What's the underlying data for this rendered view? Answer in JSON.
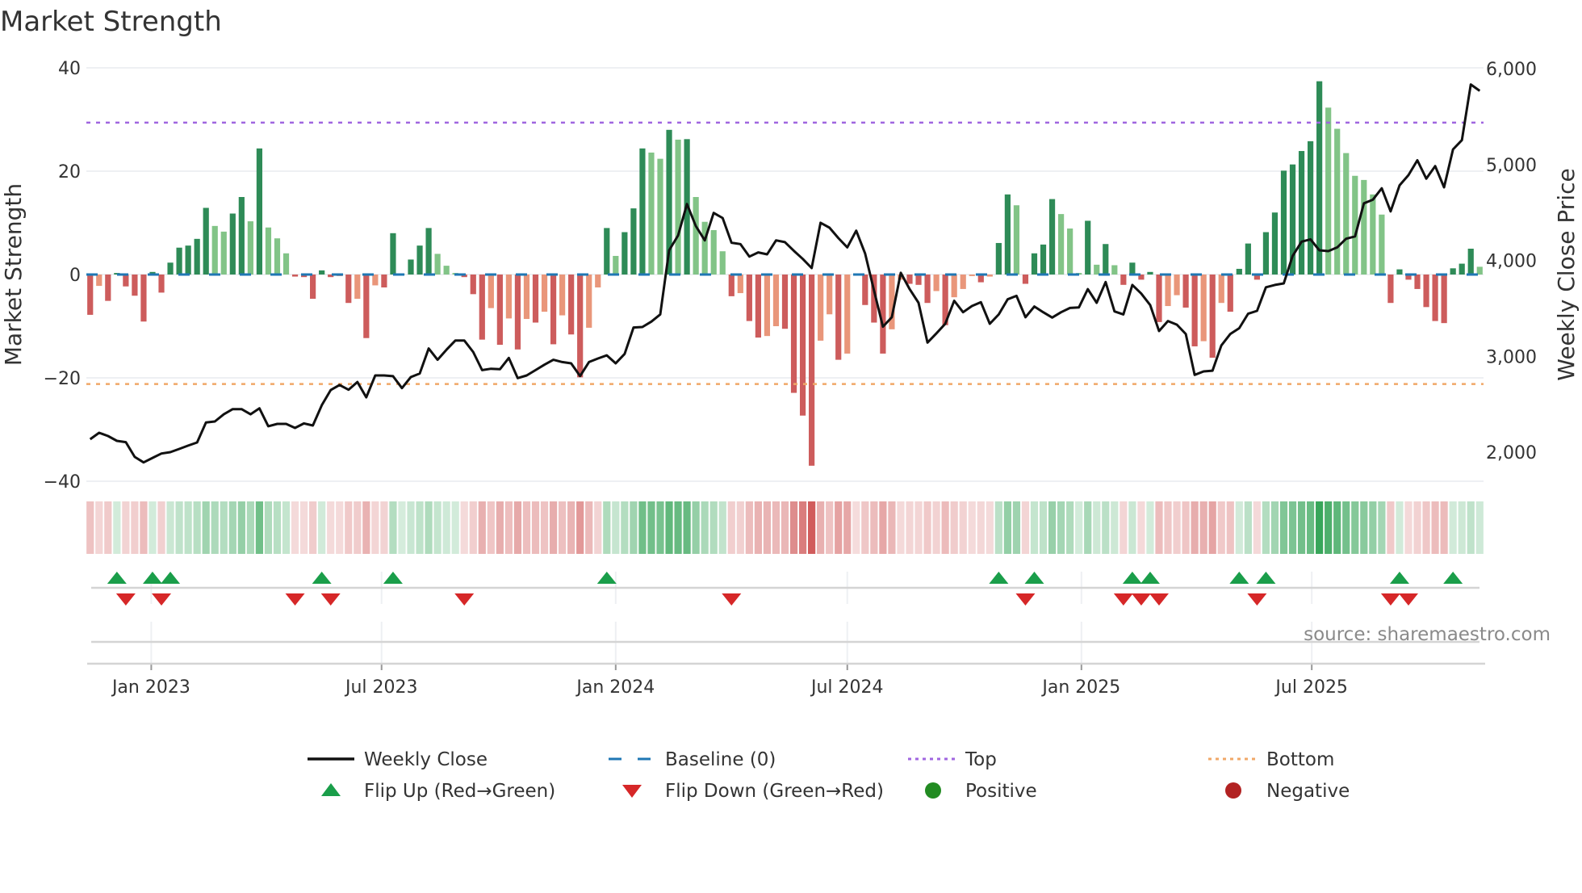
{
  "chart_data": {
    "type": "bar+line",
    "title": "Market Strength",
    "left_axis": {
      "label": "Market Strength",
      "ylim": [
        -40,
        40
      ],
      "ticks": [
        40,
        20,
        0,
        -20,
        -40
      ],
      "tick_labels": [
        "40",
        "20",
        "0",
        "−20",
        "−40"
      ]
    },
    "right_axis": {
      "label": "Weekly Close Price",
      "ylim": [
        1750,
        6000
      ],
      "ticks": [
        6000,
        5000,
        4000,
        3000,
        2000
      ],
      "tick_labels": [
        "6,000",
        "5,000",
        "4,000",
        "3,000",
        "2,000"
      ]
    },
    "x_axis": {
      "xlim": [
        "2022-11-11",
        "2025-11-13"
      ],
      "start_date": "2022-11-14",
      "frequency_days": 7,
      "ticks": [
        {
          "date": "2023-01-01",
          "label": "Jan 2023"
        },
        {
          "date": "2023-07-01",
          "label": "Jul 2023"
        },
        {
          "date": "2024-01-01",
          "label": "Jan 2024"
        },
        {
          "date": "2024-07-01",
          "label": "Jul 2024"
        },
        {
          "date": "2025-01-01",
          "label": "Jan 2025"
        },
        {
          "date": "2025-07-01",
          "label": "Jul 2025"
        }
      ]
    },
    "top_level": 29.4,
    "bottom_level": -21.2,
    "baseline": 0,
    "strength": [
      -7.8,
      -2.2,
      -5.1,
      0.3,
      -2.3,
      -4.1,
      -9.1,
      0.5,
      -3.5,
      2.3,
      5.2,
      5.6,
      6.9,
      12.9,
      9.4,
      8.3,
      11.8,
      15.0,
      10.3,
      24.4,
      9.1,
      7.0,
      4.1,
      -0.4,
      -0.5,
      -4.7,
      0.8,
      -0.5,
      -0.3,
      -5.5,
      -4.7,
      -12.3,
      -2.1,
      -2.5,
      8.0,
      0.1,
      2.9,
      5.6,
      9.0,
      4.0,
      1.7,
      0.3,
      -0.5,
      -3.8,
      -12.6,
      -6.5,
      -13.6,
      -8.5,
      -14.5,
      -8.6,
      -9.3,
      -7.2,
      -13.5,
      -7.9,
      -11.6,
      -19.9,
      -10.3,
      -2.5,
      9.0,
      3.6,
      8.2,
      12.8,
      24.4,
      23.6,
      22.4,
      28.0,
      26.1,
      26.2,
      15.0,
      10.2,
      8.6,
      4.5,
      -4.2,
      -3.6,
      -9.0,
      -12.2,
      -11.9,
      -10.0,
      -10.5,
      -22.9,
      -27.3,
      -37.0,
      -12.8,
      -7.7,
      -16.5,
      -15.3,
      -0.2,
      -5.9,
      -9.3,
      -15.3,
      -10.6,
      -1.0,
      -1.8,
      -2.0,
      -5.5,
      -3.2,
      -9.8,
      -4.4,
      -2.8,
      -0.3,
      -1.5,
      -0.4,
      6.1,
      15.5,
      13.4,
      -1.8,
      4.1,
      5.8,
      14.6,
      11.7,
      8.9,
      0.3,
      10.4,
      1.9,
      5.9,
      1.8,
      -2.0,
      2.3,
      -1.0,
      0.5,
      -9.2,
      -6.1,
      -4.0,
      -6.4,
      -13.9,
      -12.9,
      -16.1,
      -5.5,
      -7.2,
      1.1,
      6.0,
      -1.0,
      8.2,
      12.0,
      20.1,
      21.3,
      23.9,
      25.8,
      37.4,
      32.3,
      28.2,
      23.5,
      19.1,
      18.3,
      15.5,
      11.6,
      -5.5,
      1.0,
      -1.0,
      -2.8,
      -6.3,
      -9.0,
      -9.4,
      1.2,
      2.1,
      5.0,
      1.5
    ],
    "weekly_close": [
      2135,
      2202,
      2168,
      2118,
      2104,
      1950,
      1893,
      1940,
      1986,
      2000,
      2034,
      2068,
      2101,
      2310,
      2320,
      2395,
      2449,
      2449,
      2395,
      2457,
      2270,
      2295,
      2295,
      2253,
      2300,
      2278,
      2490,
      2648,
      2701,
      2651,
      2732,
      2572,
      2800,
      2800,
      2792,
      2668,
      2783,
      2820,
      3081,
      2963,
      3069,
      3165,
      3165,
      3044,
      2856,
      2870,
      2865,
      2983,
      2772,
      2800,
      2856,
      2912,
      2963,
      2940,
      2926,
      2794,
      2940,
      2977,
      3010,
      2926,
      3025,
      3300,
      3305,
      3362,
      3437,
      4105,
      4260,
      4588,
      4358,
      4209,
      4495,
      4442,
      4184,
      4170,
      4040,
      4083,
      4063,
      4209,
      4190,
      4100,
      4015,
      3920,
      4392,
      4341,
      4232,
      4136,
      4310,
      4072,
      3684,
      3309,
      3407,
      3870,
      3700,
      3558,
      3143,
      3239,
      3339,
      3579,
      3459,
      3524,
      3564,
      3339,
      3437,
      3594,
      3630,
      3407,
      3519,
      3459,
      3404,
      3459,
      3504,
      3510,
      3700,
      3558,
      3774,
      3468,
      3437,
      3744,
      3654,
      3534,
      3263,
      3368,
      3330,
      3233,
      2806,
      2842,
      2850,
      3113,
      3233,
      3293,
      3443,
      3474,
      3720,
      3744,
      3760,
      4047,
      4195,
      4220,
      4105,
      4097,
      4136,
      4226,
      4250,
      4595,
      4632,
      4752,
      4511,
      4783,
      4889,
      5044,
      4852,
      4984,
      4762,
      5158,
      5254,
      5835,
      5768
    ],
    "flip_up_weeks": [
      3,
      7,
      9,
      26,
      34,
      58,
      102,
      106,
      117,
      119,
      129,
      132,
      147,
      153
    ],
    "flip_down_weeks": [
      4,
      8,
      23,
      27,
      42,
      72,
      105,
      116,
      118,
      120,
      131,
      146,
      148
    ],
    "legend": {
      "placement": "bottom",
      "items": [
        {
          "key": "close",
          "label": "Weekly Close"
        },
        {
          "key": "baseline",
          "label": "Baseline (0)"
        },
        {
          "key": "top",
          "label": "Top"
        },
        {
          "key": "bottom",
          "label": "Bottom"
        },
        {
          "key": "flip_up",
          "label": "Flip Up (Red→Green)"
        },
        {
          "key": "flip_down",
          "label": "Flip Down (Green→Red)"
        },
        {
          "key": "positive",
          "label": "Positive"
        },
        {
          "key": "negative",
          "label": "Negative"
        }
      ]
    },
    "source": "source: sharemaestro.com"
  },
  "colors": {
    "green_strong": "#2e8b57",
    "green_weak": "#82c487",
    "red_strong": "#cd5c5c",
    "red_weak": "#e9967a",
    "baseline": "#1f77b4",
    "top": "#a066e0",
    "bottom": "#f0a868",
    "close": "#111111",
    "flip_up": "#1a9e4a",
    "flip_down": "#d62728",
    "positive": "#228b22",
    "negative": "#b22222",
    "heat_green": "44,160,80",
    "heat_red": "205,80,80"
  }
}
